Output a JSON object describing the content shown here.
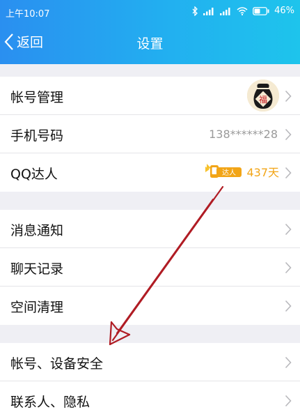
{
  "status_bar": {
    "time": "上午10:07",
    "battery": "46%"
  },
  "nav": {
    "back_label": "返回",
    "title": "设置"
  },
  "groups": [
    [
      {
        "label": "帐号管理",
        "trailing": "avatar"
      },
      {
        "label": "手机号码",
        "value": "138******28"
      },
      {
        "label": "QQ达人",
        "badge_text": "达人",
        "value": "437天"
      }
    ],
    [
      {
        "label": "消息通知"
      },
      {
        "label": "聊天记录"
      },
      {
        "label": "空间清理"
      }
    ],
    [
      {
        "label": "帐号、设备安全"
      },
      {
        "label": "联系人、隐私"
      }
    ]
  ],
  "avatar_text": "福",
  "colors": {
    "header_start": "#2a8ff0",
    "header_end": "#1ec4ec",
    "accent_days": "#f2a517",
    "annotation_arrow": "#b01c24"
  }
}
